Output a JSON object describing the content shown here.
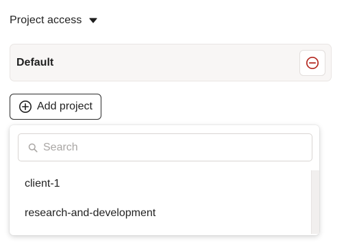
{
  "section": {
    "title": "Project access",
    "caret_icon": "caret-down-icon"
  },
  "project_row": {
    "name": "Default",
    "remove_icon": "minus-circle-icon",
    "remove_color": "#b3261e"
  },
  "add_button": {
    "label": "Add project",
    "icon": "plus-circle-icon"
  },
  "dropdown": {
    "search": {
      "placeholder": "Search",
      "value": "",
      "icon": "search-icon"
    },
    "options": [
      {
        "label": "client-1"
      },
      {
        "label": "research-and-development"
      }
    ]
  }
}
